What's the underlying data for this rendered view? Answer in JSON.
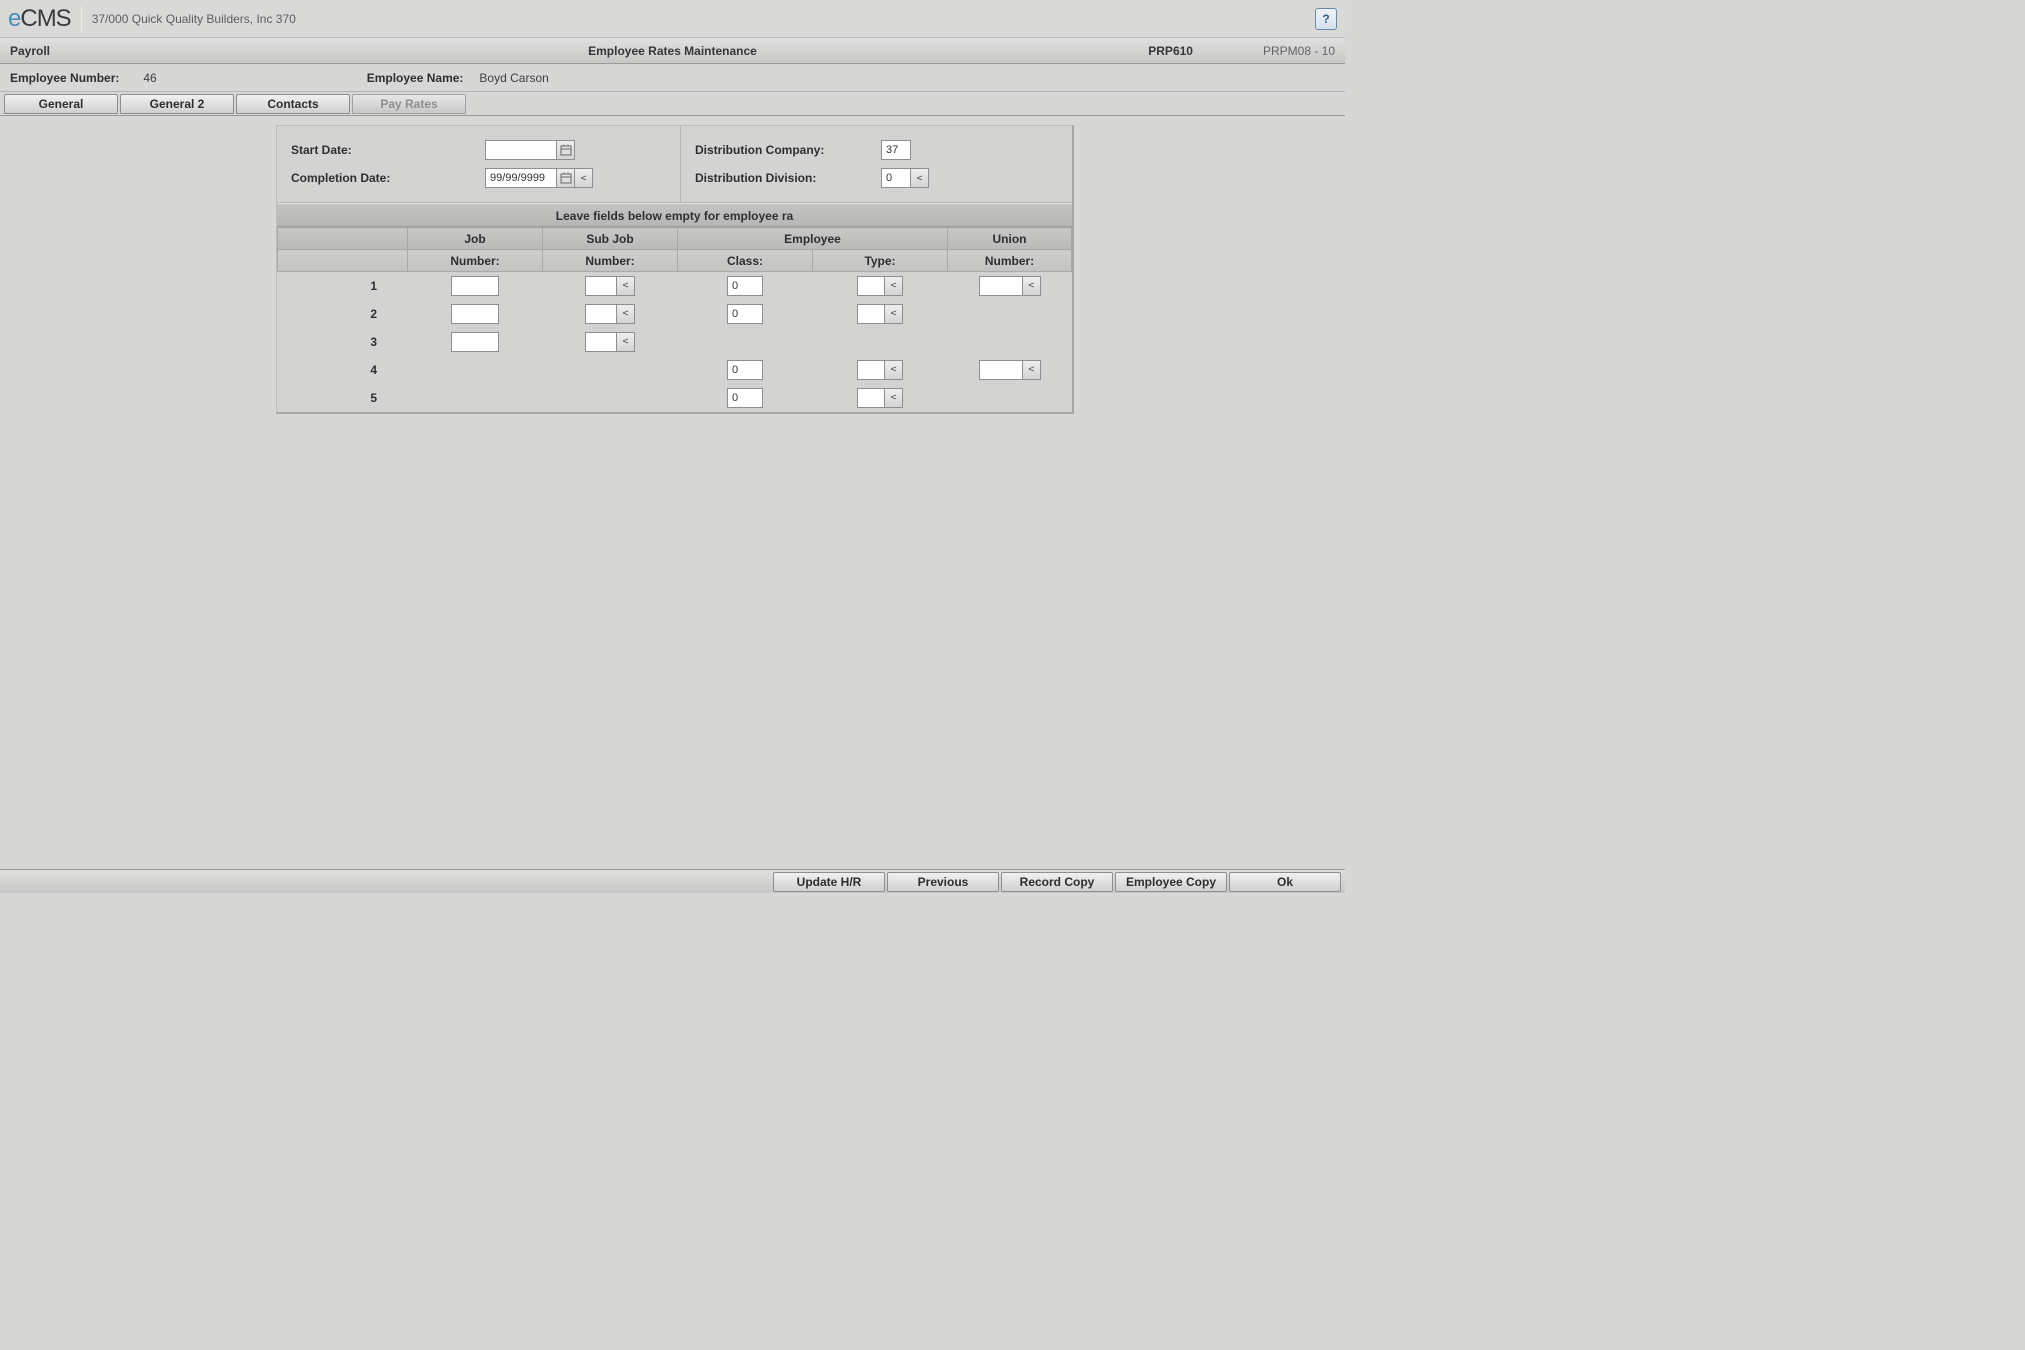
{
  "topbar": {
    "logo_e": "e",
    "logo_rest": "CMS",
    "company_info": "37/000   Quick Quality Builders, Inc 370",
    "help_glyph": "?"
  },
  "titlebar": {
    "module": "Payroll",
    "title": "Employee Rates Maintenance",
    "code1": "PRP610",
    "code2": "PRPM08 - 10"
  },
  "infobar": {
    "emp_num_label": "Employee Number:",
    "emp_num_value": "46",
    "emp_name_label": "Employee Name:",
    "emp_name_value": "Boyd Carson"
  },
  "tabs": {
    "general": "General",
    "general2": "General 2",
    "contacts": "Contacts",
    "payrates": "Pay Rates"
  },
  "fields": {
    "start_date_label": "Start Date:",
    "start_date_value": "",
    "completion_date_label": "Completion Date:",
    "completion_date_value": "99/99/9999",
    "dist_company_label": "Distribution Company:",
    "dist_company_value": "37",
    "dist_division_label": "Distribution Division:",
    "dist_division_value": "0",
    "lookup_glyph": "<"
  },
  "banner": "Leave fields below empty for employee ra",
  "grid": {
    "top_headers": {
      "blank": "",
      "job": "Job",
      "subjob": "Sub Job",
      "employee": "Employee",
      "union": "Union"
    },
    "sub_headers": {
      "blank": "",
      "jobnum": "Number:",
      "subjobnum": "Number:",
      "empclass": "Class:",
      "emptype": "Type:",
      "unionnum": "Number:"
    },
    "rows": {
      "r1": {
        "idx": "1",
        "job": "",
        "subjob": "",
        "class": "0",
        "type": "",
        "union": ""
      },
      "r2": {
        "idx": "2",
        "job": "",
        "subjob": "",
        "class": "0",
        "type": "",
        "union": ""
      },
      "r3": {
        "idx": "3",
        "job": "",
        "subjob": ""
      },
      "r4": {
        "idx": "4",
        "class": "0",
        "type": "",
        "union": ""
      },
      "r5": {
        "idx": "5",
        "class": "0",
        "type": ""
      }
    }
  },
  "buttons": {
    "update_hr": "Update H/R",
    "previous": "Previous",
    "record_copy": "Record Copy",
    "employee_copy": "Employee Copy",
    "ok": "Ok"
  }
}
